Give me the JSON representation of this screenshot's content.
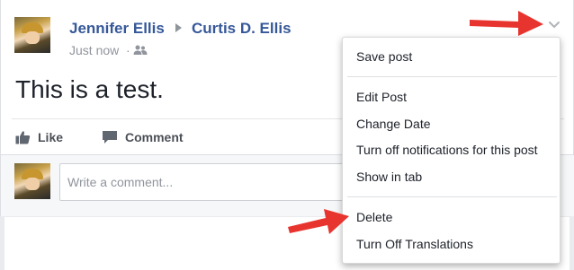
{
  "post": {
    "author": "Jennifer Ellis",
    "target": "Curtis D. Ellis",
    "timestamp": "Just now",
    "separator": "·",
    "audience_icon": "friends-icon",
    "text": "This is a test.",
    "link_color": "#365899"
  },
  "actions": {
    "like_label": "Like",
    "comment_label": "Comment"
  },
  "comment_box": {
    "placeholder": "Write a comment..."
  },
  "menu": {
    "items": [
      {
        "label": "Save post"
      },
      {
        "label": "Edit Post"
      },
      {
        "label": "Change Date"
      },
      {
        "label": "Turn off notifications for this post"
      },
      {
        "label": "Show in tab"
      },
      {
        "label": "Delete"
      },
      {
        "label": "Turn Off Translations"
      }
    ]
  },
  "annotations": {
    "arrow_color": "#e8342f"
  }
}
